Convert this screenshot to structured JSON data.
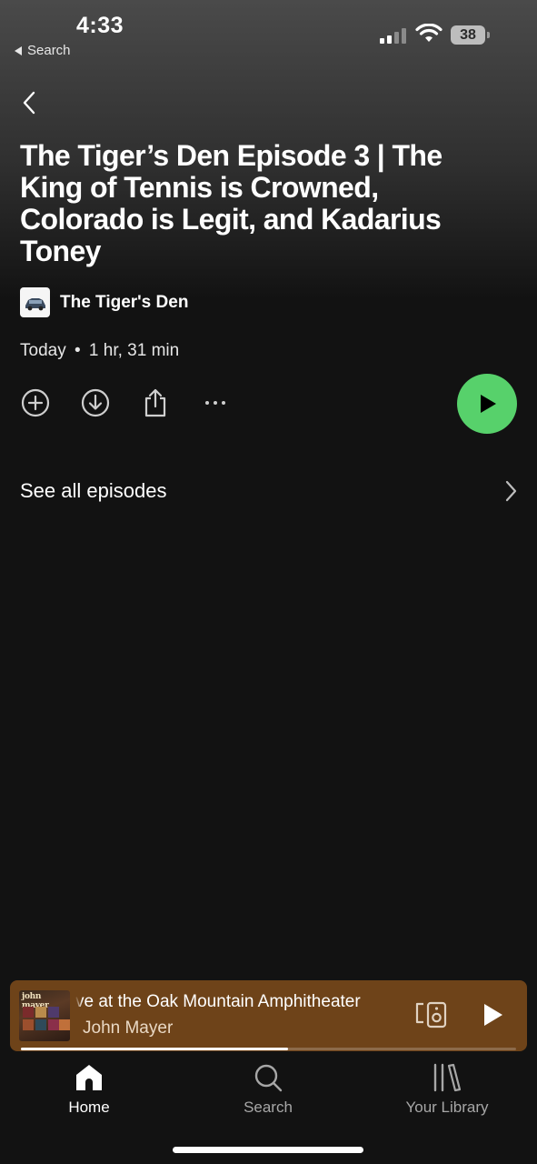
{
  "status_bar": {
    "time": "4:33",
    "back_app": "Search",
    "battery": "38"
  },
  "episode": {
    "title": "The Tiger’s Den Episode 3 | The King of Tennis is Crowned, Colorado is Legit, and Kadarius Toney",
    "show_name": "The Tiger's Den",
    "date": "Today",
    "separator": "•",
    "duration": "1 hr, 31 min"
  },
  "actions": {
    "icons": [
      "add-icon",
      "download-icon",
      "share-icon",
      "more-icon"
    ],
    "play_color": "#57d16b"
  },
  "see_all": {
    "label": "See all episodes"
  },
  "mini_player": {
    "title": "ve at the Oak Mountain Amphitheater",
    "artist": "John Mayer",
    "art_text": "john mayer",
    "background": "#6e4319",
    "progress": 0.54
  },
  "tabs": [
    {
      "label": "Home",
      "icon": "home-icon",
      "active": true
    },
    {
      "label": "Search",
      "icon": "search-icon",
      "active": false
    },
    {
      "label": "Your Library",
      "icon": "library-icon",
      "active": false
    }
  ]
}
